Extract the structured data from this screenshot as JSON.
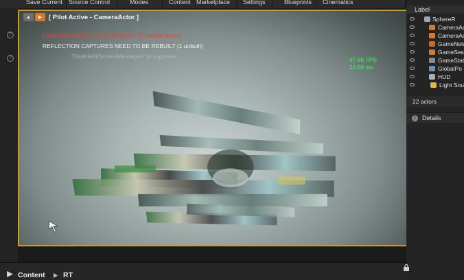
{
  "toolbar": {
    "items": [
      {
        "label": "Save Current"
      },
      {
        "label": "Source Control"
      },
      {
        "label": "Modes"
      },
      {
        "label": "Content"
      },
      {
        "label": "Marketplace"
      },
      {
        "label": "Settings"
      },
      {
        "label": "Blueprints"
      },
      {
        "label": "Cinematics"
      }
    ]
  },
  "viewport": {
    "pilot_label": "[ Pilot Active - CameraActor ]",
    "messages": {
      "lighting": "LIGHTING NEEDS TO BE REBUILT (1 unbuilt object)",
      "reflection": "REFLECTION CAPTURES NEED TO BE REBUILT (1 unbuilt)",
      "suppress": "'DisableAllScreenMessages' to suppress"
    },
    "fps": "47.86 FPS",
    "ms": "20.90 ms",
    "accent_color": "#c99a2e",
    "stat_color": "#2cff4a",
    "warning_color": "#ff3a2a"
  },
  "outliner": {
    "column_label": "Label",
    "rows": [
      {
        "label": "SphereR",
        "icon": "sphere-reflection-icon",
        "color": "#9aa7b5"
      },
      {
        "label": "CameraAc",
        "icon": "camera-icon",
        "color": "#d07a33"
      },
      {
        "label": "CameraAc",
        "icon": "camera-icon",
        "color": "#d07a33"
      },
      {
        "label": "GameNetw",
        "icon": "gamenetwork-icon",
        "color": "#c86a2e"
      },
      {
        "label": "GameSes",
        "icon": "gamesession-icon",
        "color": "#d07a33"
      },
      {
        "label": "GameStat",
        "icon": "gamestate-icon",
        "color": "#8a8a8a"
      },
      {
        "label": "GlobalPo",
        "icon": "postprocess-icon",
        "color": "#6b8fb5"
      },
      {
        "label": "HUD",
        "icon": "hud-icon",
        "color": "#b0b0b0"
      },
      {
        "label": "Light Sou",
        "icon": "light-icon",
        "color": "#e0b84a"
      }
    ],
    "actor_count": "22 actors",
    "details_label": "Details"
  },
  "bottom": {
    "content_label": "Content",
    "folder_label": "RT"
  }
}
